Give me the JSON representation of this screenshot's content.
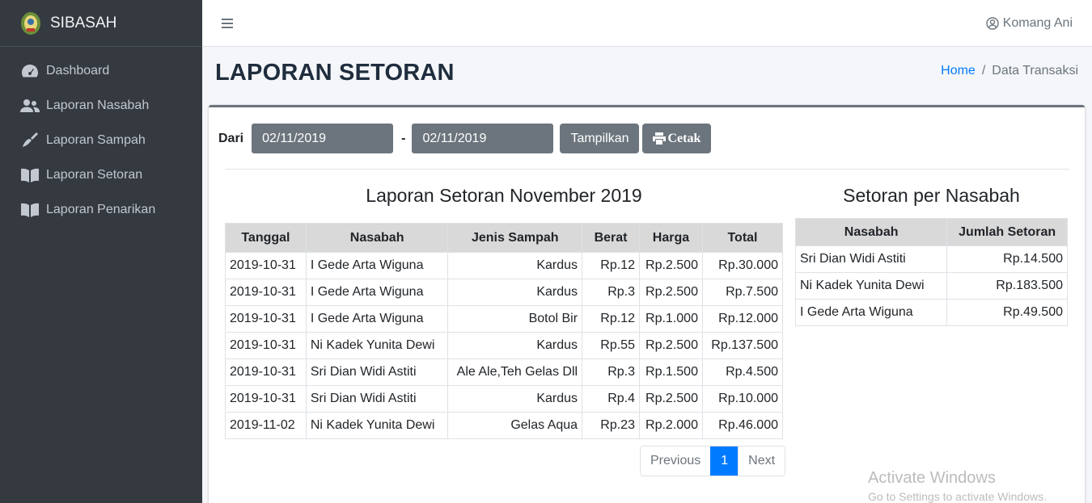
{
  "brand": {
    "name": "SIBASAH"
  },
  "sidebar": {
    "items": [
      {
        "label": "Dashboard",
        "icon": "tachometer-icon"
      },
      {
        "label": "Laporan Nasabah",
        "icon": "users-icon"
      },
      {
        "label": "Laporan Sampah",
        "icon": "broom-icon"
      },
      {
        "label": "Laporan Setoran",
        "icon": "book-open-icon"
      },
      {
        "label": "Laporan Penarikan",
        "icon": "book-open-icon"
      }
    ]
  },
  "topbar": {
    "user": "Komang Ani"
  },
  "header": {
    "title": "LAPORAN SETORAN",
    "breadcrumb": {
      "home": "Home",
      "separator": "/",
      "current": "Data Transaksi"
    }
  },
  "filter": {
    "label": "Dari",
    "from": "02/11/2019",
    "separator": "-",
    "to": "02/11/2019",
    "show_button": "Tampilkan",
    "print_button": "Cetak"
  },
  "left_table": {
    "title": "Laporan Setoran November 2019",
    "columns": [
      "Tanggal",
      "Nasabah",
      "Jenis Sampah",
      "Berat",
      "Harga",
      "Total"
    ],
    "rows": [
      [
        "2019-10-31",
        "I Gede Arta Wiguna",
        "Kardus",
        "Rp.12",
        "Rp.2.500",
        "Rp.30.000"
      ],
      [
        "2019-10-31",
        "I Gede Arta Wiguna",
        "Kardus",
        "Rp.3",
        "Rp.2.500",
        "Rp.7.500"
      ],
      [
        "2019-10-31",
        "I Gede Arta Wiguna",
        "Botol Bir",
        "Rp.12",
        "Rp.1.000",
        "Rp.12.000"
      ],
      [
        "2019-10-31",
        "Ni Kadek Yunita Dewi",
        "Kardus",
        "Rp.55",
        "Rp.2.500",
        "Rp.137.500"
      ],
      [
        "2019-10-31",
        "Sri Dian Widi Astiti",
        "Ale Ale,Teh Gelas Dll",
        "Rp.3",
        "Rp.1.500",
        "Rp.4.500"
      ],
      [
        "2019-10-31",
        "Sri Dian Widi Astiti",
        "Kardus",
        "Rp.4",
        "Rp.2.500",
        "Rp.10.000"
      ],
      [
        "2019-11-02",
        "Ni Kadek Yunita Dewi",
        "Gelas Aqua",
        "Rp.23",
        "Rp.2.000",
        "Rp.46.000"
      ]
    ]
  },
  "right_table": {
    "title": "Setoran per Nasabah",
    "columns": [
      "Nasabah",
      "Jumlah Setoran"
    ],
    "rows": [
      [
        "Sri Dian Widi Astiti",
        "Rp.14.500"
      ],
      [
        "Ni Kadek Yunita Dewi",
        "Rp.183.500"
      ],
      [
        "I Gede Arta Wiguna",
        "Rp.49.500"
      ]
    ]
  },
  "pagination": {
    "previous": "Previous",
    "current": "1",
    "next": "Next"
  },
  "watermark": {
    "line1": "Activate Windows",
    "line2": "Go to Settings to activate Windows."
  },
  "colors": {
    "sidebar": "#343a40",
    "accent": "#007bff",
    "button": "#6c757d"
  }
}
